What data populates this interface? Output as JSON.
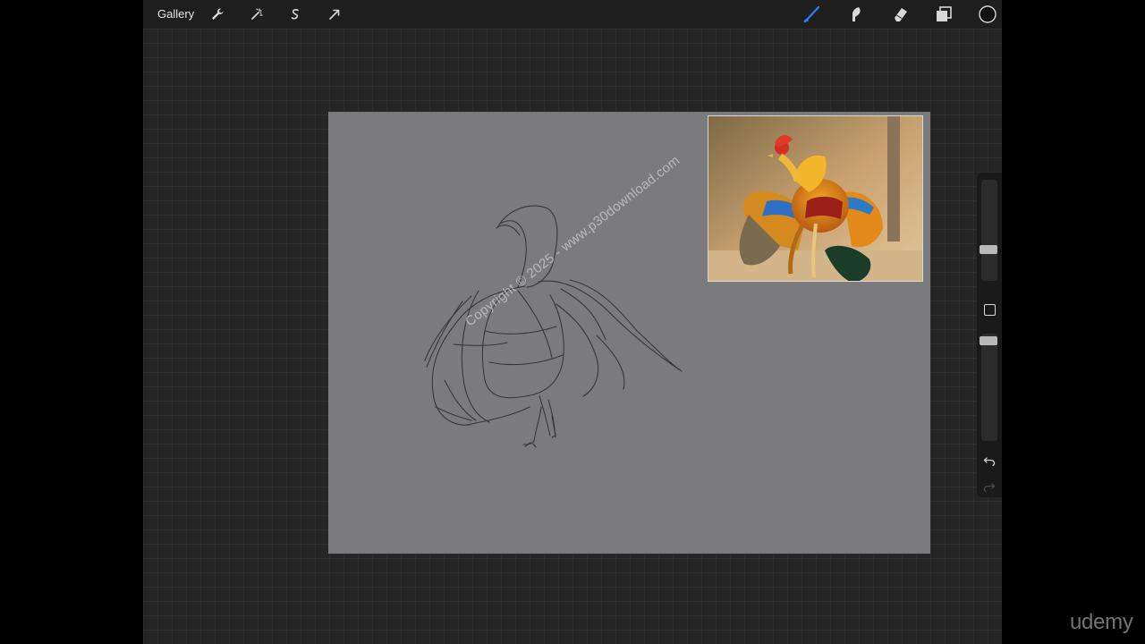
{
  "topbar": {
    "gallery_label": "Gallery",
    "left_tools": [
      "wrench-icon",
      "magic-wand-icon",
      "selection-icon",
      "transform-arrow-icon"
    ],
    "right_tools": [
      "brush-icon",
      "smudge-icon",
      "eraser-icon",
      "layers-icon",
      "color-icon"
    ],
    "active_tool_color": "#2f7cf6"
  },
  "sidebar": {
    "brush_size": 0.29,
    "brush_opacity": 0.97,
    "undo": "undo-icon",
    "redo": "redo-icon"
  },
  "canvas": {
    "background_color": "#7b7b7d",
    "watermark": "Copyright © 2025 - www.p30download.com"
  },
  "branding": {
    "udemy": "udemy"
  }
}
